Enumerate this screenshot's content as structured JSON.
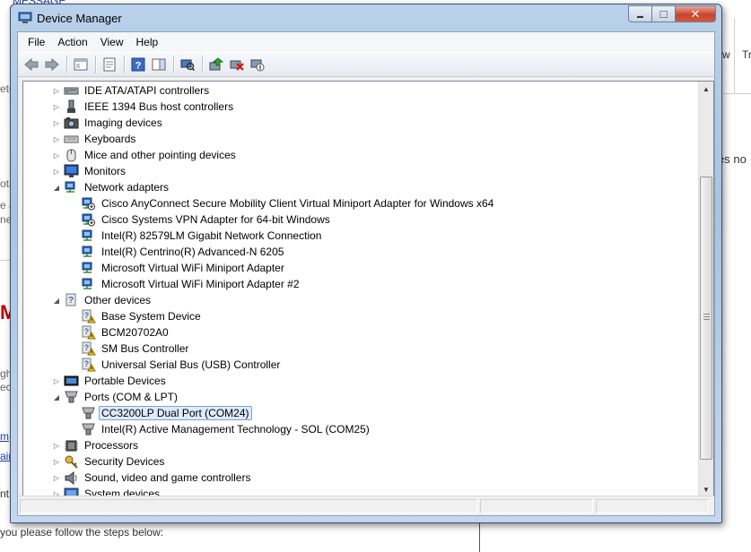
{
  "background": {
    "top_link": "MESSAGE",
    "frag_ete": "ete",
    "frag_ota": "ota",
    "frag_e_a": "e a",
    "frag_ner": "ner",
    "frag_m": "M",
    "frag_ght": "ght",
    "frag_ece": "ece",
    "frag_m_link": "m",
    "frag_ain_link": "ain",
    "frag_nt": "nt",
    "right_w": "w",
    "right_tr": "Tr",
    "right_es_no": "es no",
    "bottom_text": "you please follow the steps below:"
  },
  "window": {
    "title": "Device Manager",
    "minimize_glyph": "▬",
    "maximize_glyph": "□",
    "close_glyph": "✕"
  },
  "menu": {
    "file": "File",
    "action": "Action",
    "view": "View",
    "help": "Help"
  },
  "toolbar_icons": [
    "back-icon",
    "forward-icon",
    "show-hide-console-tree-icon",
    "properties-icon",
    "help-icon",
    "action-pane-icon",
    "scan-hardware-icon",
    "update-driver-icon",
    "uninstall-icon",
    "disable-icon"
  ],
  "tree": [
    {
      "label": "IDE ATA/ATAPI controllers",
      "level": 0,
      "expander": "▷",
      "icon": "ide-controller-icon"
    },
    {
      "label": "IEEE 1394 Bus host controllers",
      "level": 0,
      "expander": "▷",
      "icon": "ieee1394-icon"
    },
    {
      "label": "Imaging devices",
      "level": 0,
      "expander": "▷",
      "icon": "camera-icon"
    },
    {
      "label": "Keyboards",
      "level": 0,
      "expander": "▷",
      "icon": "keyboard-icon"
    },
    {
      "label": "Mice and other pointing devices",
      "level": 0,
      "expander": "▷",
      "icon": "mouse-icon"
    },
    {
      "label": "Monitors",
      "level": 0,
      "expander": "▷",
      "icon": "monitor-icon"
    },
    {
      "label": "Network adapters",
      "level": 0,
      "expander": "◢",
      "icon": "network-adapter-icon"
    },
    {
      "label": "Cisco AnyConnect Secure Mobility Client Virtual Miniport Adapter for Windows x64",
      "level": 1,
      "expander": "",
      "icon": "network-adapter-warning-icon"
    },
    {
      "label": "Cisco Systems VPN Adapter for 64-bit Windows",
      "level": 1,
      "expander": "",
      "icon": "network-adapter-warning-icon"
    },
    {
      "label": "Intel(R) 82579LM Gigabit Network Connection",
      "level": 1,
      "expander": "",
      "icon": "network-adapter-icon"
    },
    {
      "label": "Intel(R) Centrino(R) Advanced-N 6205",
      "level": 1,
      "expander": "",
      "icon": "network-adapter-icon"
    },
    {
      "label": "Microsoft Virtual WiFi Miniport Adapter",
      "level": 1,
      "expander": "",
      "icon": "network-adapter-icon"
    },
    {
      "label": "Microsoft Virtual WiFi Miniport Adapter #2",
      "level": 1,
      "expander": "",
      "icon": "network-adapter-icon"
    },
    {
      "label": "Other devices",
      "level": 0,
      "expander": "◢",
      "icon": "unknown-device-icon"
    },
    {
      "label": "Base System Device",
      "level": 1,
      "expander": "",
      "icon": "unknown-device-warning-icon"
    },
    {
      "label": "BCM20702A0",
      "level": 1,
      "expander": "",
      "icon": "unknown-device-warning-icon"
    },
    {
      "label": "SM Bus Controller",
      "level": 1,
      "expander": "",
      "icon": "unknown-device-warning-icon"
    },
    {
      "label": "Universal Serial Bus (USB) Controller",
      "level": 1,
      "expander": "",
      "icon": "unknown-device-warning-icon"
    },
    {
      "label": "Portable Devices",
      "level": 0,
      "expander": "▷",
      "icon": "portable-device-icon"
    },
    {
      "label": "Ports (COM & LPT)",
      "level": 0,
      "expander": "◢",
      "icon": "port-icon"
    },
    {
      "label": "CC3200LP Dual Port (COM24)",
      "level": 1,
      "expander": "",
      "icon": "port-icon",
      "selected": true
    },
    {
      "label": "Intel(R) Active Management Technology - SOL (COM25)",
      "level": 1,
      "expander": "",
      "icon": "port-icon"
    },
    {
      "label": "Processors",
      "level": 0,
      "expander": "▷",
      "icon": "processor-icon"
    },
    {
      "label": "Security Devices",
      "level": 0,
      "expander": "▷",
      "icon": "security-device-icon"
    },
    {
      "label": "Sound, video and game controllers",
      "level": 0,
      "expander": "▷",
      "icon": "speaker-icon"
    },
    {
      "label": "System devices",
      "level": 0,
      "expander": "▷",
      "icon": "system-device-icon"
    }
  ],
  "scrollbar": {
    "up_glyph": "▲",
    "down_glyph": "▼"
  }
}
